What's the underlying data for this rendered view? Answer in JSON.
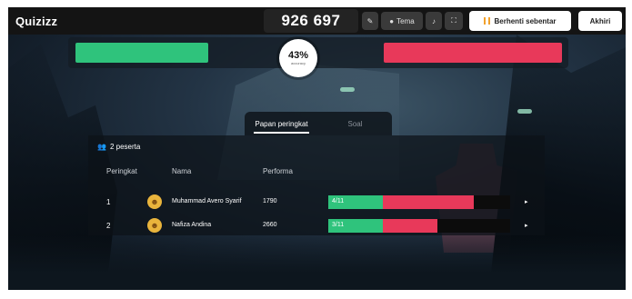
{
  "topbar": {
    "logo": "Quizizz",
    "game_code": "926 697",
    "theme_label": "Tema",
    "pause_label": "Berhenti sebentar",
    "end_label": "Akhiri"
  },
  "progress": {
    "percent": "43%",
    "percent_caption": "accuracy",
    "correct_fraction": 0.43
  },
  "tabs": [
    {
      "label": "Papan peringkat",
      "active": true
    },
    {
      "label": "Soal",
      "active": false
    }
  ],
  "leaderboard": {
    "players_count": "2 peserta",
    "headers": {
      "rank": "Peringkat",
      "name": "Nama",
      "performance": "Performa"
    },
    "rows": [
      {
        "rank": "1",
        "name": "Muhammad Avero Syarif",
        "score": "1790",
        "label": "4/11",
        "green": 0.3,
        "red": 0.5
      },
      {
        "rank": "2",
        "name": "Nafiza Andina",
        "score": "2660",
        "label": "3/11",
        "green": 0.3,
        "red": 0.3
      }
    ]
  },
  "colors": {
    "correct": "#2fc37c",
    "incorrect": "#e8395a",
    "accent": "#f2a12c"
  }
}
